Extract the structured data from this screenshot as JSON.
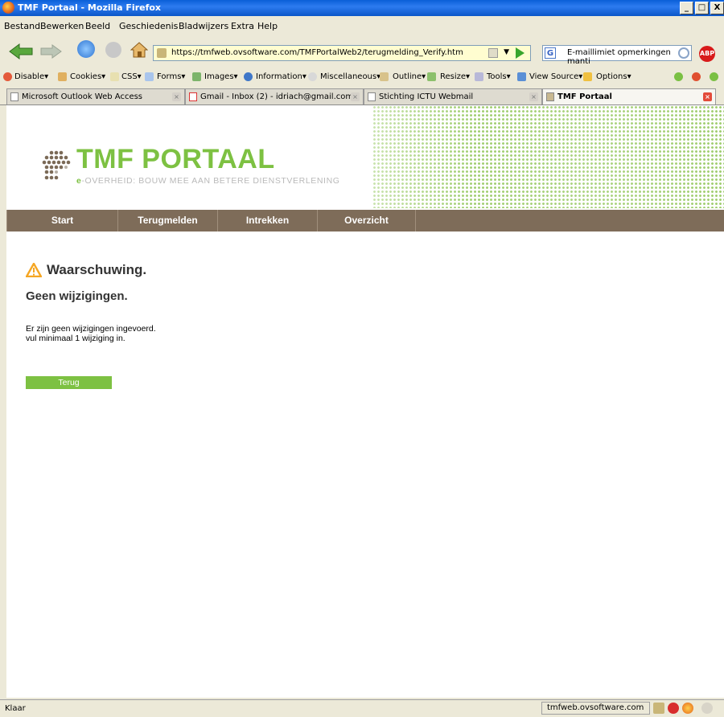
{
  "window": {
    "title": "TMF Portaal - Mozilla Firefox",
    "min": "_",
    "max": "□",
    "close": "X"
  },
  "menu": [
    "Bestand",
    "Bewerken",
    "Beeld",
    "Geschiedenis",
    "Bladwijzers",
    "Extra",
    "Help"
  ],
  "address": {
    "url": "https://tmfweb.ovsoftware.com/TMFPortalWeb2/terugmelding_Verify.htm"
  },
  "search": {
    "value": "E-maillimiet opmerkingen manti"
  },
  "abp_label": "ABP",
  "devbar": [
    "Disable▾",
    "Cookies▾",
    "CSS▾",
    "Forms▾",
    "Images▾",
    "Information▾",
    "Miscellaneous▾",
    "Outline▾",
    "Resize▾",
    "Tools▾",
    "View Source▾",
    "Options▾"
  ],
  "tabs": [
    {
      "label": "Microsoft Outlook Web Access"
    },
    {
      "label": "Gmail - Inbox (2) - idriach@gmail.com"
    },
    {
      "label": "Stichting ICTU Webmail"
    },
    {
      "label": "TMF Portaal"
    }
  ],
  "page": {
    "logo_main": "TMF PORTAAL",
    "logo_sub_e": "e",
    "logo_sub": "-OVERHEID: BOUW MEE AAN BETERE DIENSTVERLENING",
    "nav": [
      "Start",
      "Terugmelden",
      "Intrekken",
      "Overzicht"
    ],
    "warning_title": "Waarschuwing.",
    "subtitle": "Geen wijzigingen.",
    "message_line1": "Er zijn geen wijzigingen ingevoerd.",
    "message_line2": "vul minimaal 1 wijziging in.",
    "back_button": "Terug"
  },
  "status": {
    "text": "Klaar",
    "host": "tmfweb.ovsoftware.com"
  },
  "colors": {
    "brand_green": "#7dc142",
    "nav_brown": "#7e6c59",
    "warning_orange": "#f5a623"
  }
}
